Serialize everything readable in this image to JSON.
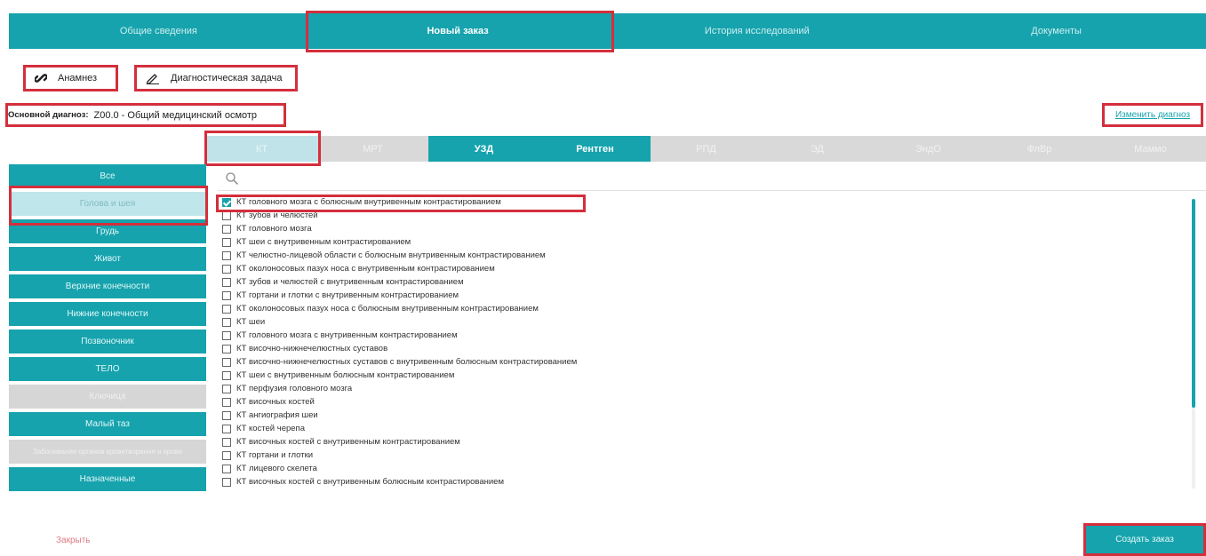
{
  "top_tabs": [
    {
      "label": "Общие сведения",
      "active": false
    },
    {
      "label": "Новый заказ",
      "active": true
    },
    {
      "label": "История исследований",
      "active": false
    },
    {
      "label": "Документы",
      "active": false
    }
  ],
  "actions": {
    "anamnesis": "Анамнез",
    "diagnostic_task": "Диагностическая задача"
  },
  "diagnosis": {
    "label": "Основной диагноз:",
    "value": "Z00.0 - Общий медицинский осмотр",
    "change_link": "Изменить диагноз"
  },
  "modalities": [
    {
      "label": "КТ",
      "state": "selected"
    },
    {
      "label": "МРТ",
      "state": "disabled"
    },
    {
      "label": "УЗД",
      "state": "enabled"
    },
    {
      "label": "Рентген",
      "state": "enabled"
    },
    {
      "label": "РПД",
      "state": "disabled"
    },
    {
      "label": "ЭД",
      "state": "disabled"
    },
    {
      "label": "ЭндО",
      "state": "disabled"
    },
    {
      "label": "ФлВр",
      "state": "disabled"
    },
    {
      "label": "Маммо",
      "state": "disabled"
    }
  ],
  "categories": [
    {
      "label": "Все",
      "state": "normal"
    },
    {
      "label": "Голова и шея",
      "state": "active"
    },
    {
      "label": "Грудь",
      "state": "normal"
    },
    {
      "label": "Живот",
      "state": "normal"
    },
    {
      "label": "Верхние конечности",
      "state": "normal"
    },
    {
      "label": "Нижние конечности",
      "state": "normal"
    },
    {
      "label": "Позвоночник",
      "state": "normal"
    },
    {
      "label": "ТЕЛО",
      "state": "normal"
    },
    {
      "label": "Ключица",
      "state": "disabled"
    },
    {
      "label": "Малый таз",
      "state": "normal"
    },
    {
      "label": "Заболевания органов кроветворения и крови",
      "state": "disabled"
    },
    {
      "label": "Назначенные",
      "state": "normal"
    }
  ],
  "studies": [
    {
      "label": "КТ головного мозга с болюсным внутривенным контрастированием",
      "checked": true
    },
    {
      "label": "КТ зубов и челюстей",
      "checked": false
    },
    {
      "label": "КТ головного мозга",
      "checked": false
    },
    {
      "label": "КТ шеи с внутривенным контрастированием",
      "checked": false
    },
    {
      "label": "КТ челюстно-лицевой области с болюсным внутривенным контрастированием",
      "checked": false
    },
    {
      "label": "КТ околоносовых пазух носа с внутривенным контрастированием",
      "checked": false
    },
    {
      "label": "КТ зубов и челюстей с внутривенным контрастированием",
      "checked": false
    },
    {
      "label": "КТ гортани и глотки с внутривенным контрастированием",
      "checked": false
    },
    {
      "label": "КТ околоносовых пазух носа с болюсным внутривенным контрастированием",
      "checked": false
    },
    {
      "label": "КТ шеи",
      "checked": false
    },
    {
      "label": "КТ головного мозга с внутривенным контрастированием",
      "checked": false
    },
    {
      "label": "КТ височно-нижнечелюстных суставов",
      "checked": false
    },
    {
      "label": "КТ височно-нижнечелюстных суставов с внутривенным болюсным контрастированием",
      "checked": false
    },
    {
      "label": "КТ шеи с внутривенным болюсным контрастированием",
      "checked": false
    },
    {
      "label": "КТ перфузия головного мозга",
      "checked": false
    },
    {
      "label": "КТ височных костей",
      "checked": false
    },
    {
      "label": "КТ ангиография шеи",
      "checked": false
    },
    {
      "label": "КТ костей черепа",
      "checked": false
    },
    {
      "label": "КТ височных костей с внутривенным контрастированием",
      "checked": false
    },
    {
      "label": "КТ гортани и глотки",
      "checked": false
    },
    {
      "label": "КТ лицевого скелета",
      "checked": false
    },
    {
      "label": "КТ височных костей с внутривенным болюсным контрастированием",
      "checked": false
    }
  ],
  "footer": {
    "close": "Закрыть",
    "create": "Создать заказ"
  },
  "colors": {
    "accent": "#16a3ad",
    "highlight": "#d32f3c"
  },
  "scroll_fraction": 0.72
}
